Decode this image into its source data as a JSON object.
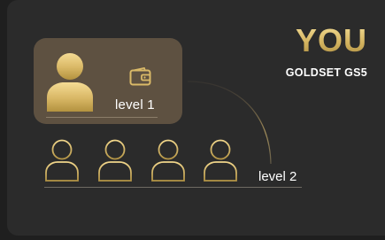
{
  "header": {
    "title": "YOU",
    "subtitle": "GOLDSET GS5"
  },
  "level1": {
    "label": "level 1",
    "icons": [
      "user-icon",
      "wallet-icon"
    ]
  },
  "level2": {
    "label": "level 2",
    "member_count": 4
  },
  "colors": {
    "gold_light": "#f7e29b",
    "gold_dark": "#a98a3f",
    "card_bg": "#5e5141",
    "panel_bg": "#2b2b2b"
  }
}
